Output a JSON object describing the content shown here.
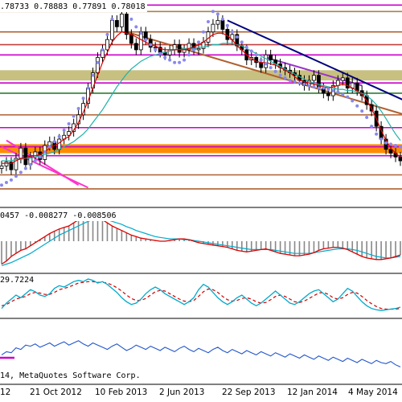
{
  "chart_data": {
    "type": "line",
    "header": {
      "ohlc_text": ".78733 0.78883 0.77891 0.78018",
      "macd_text": "0457 -0.008277 -0.008506",
      "rsi_text": "29.7224",
      "copyright_text": "14, MetaQuotes Software Corp."
    },
    "x_ticks": [
      "12",
      "21 Oct 2012",
      "10 Feb 2013",
      "2 Jun 2013",
      "22 Sep 2013",
      "12 Jan 2014",
      "4 May 2014"
    ],
    "main": {
      "ylim": [
        0.745,
        0.905
      ],
      "series": {
        "close": [
          0.775,
          0.778,
          0.772,
          0.781,
          0.789,
          0.776,
          0.782,
          0.786,
          0.78,
          0.791,
          0.794,
          0.788,
          0.796,
          0.799,
          0.802,
          0.808,
          0.815,
          0.824,
          0.836,
          0.848,
          0.86,
          0.866,
          0.874,
          0.889,
          0.884,
          0.894,
          0.878,
          0.871,
          0.866,
          0.88,
          0.874,
          0.868,
          0.868,
          0.864,
          0.862,
          0.866,
          0.87,
          0.864,
          0.866,
          0.871,
          0.866,
          0.867,
          0.872,
          0.88,
          0.886,
          0.889,
          0.882,
          0.874,
          0.878,
          0.869,
          0.866,
          0.858,
          0.86,
          0.856,
          0.852,
          0.862,
          0.858,
          0.855,
          0.852,
          0.85,
          0.848,
          0.846,
          0.842,
          0.838,
          0.842,
          0.846,
          0.836,
          0.832,
          0.83,
          0.838,
          0.842,
          0.844,
          0.836,
          0.84,
          0.834,
          0.83,
          0.823,
          0.818,
          0.806,
          0.796,
          0.788,
          0.785,
          0.782,
          0.779
        ],
        "ma_fast": [
          0.777,
          0.777,
          0.777,
          0.779,
          0.781,
          0.781,
          0.783,
          0.783,
          0.784,
          0.786,
          0.789,
          0.791,
          0.793,
          0.796,
          0.798,
          0.803,
          0.809,
          0.817,
          0.826,
          0.836,
          0.846,
          0.856,
          0.864,
          0.872,
          0.877,
          0.88,
          0.879,
          0.878,
          0.876,
          0.874,
          0.872,
          0.87,
          0.869,
          0.867,
          0.866,
          0.866,
          0.866,
          0.866,
          0.866,
          0.867,
          0.868,
          0.87,
          0.872,
          0.875,
          0.878,
          0.879,
          0.879,
          0.877,
          0.874,
          0.869,
          0.866,
          0.862,
          0.859,
          0.857,
          0.856,
          0.856,
          0.855,
          0.854,
          0.852,
          0.85,
          0.848,
          0.845,
          0.842,
          0.841,
          0.84,
          0.839,
          0.838,
          0.837,
          0.836,
          0.837,
          0.838,
          0.839,
          0.838,
          0.836,
          0.834,
          0.831,
          0.826,
          0.82,
          0.812,
          0.803,
          0.795,
          0.789,
          0.785,
          0.782
        ],
        "ma_slow": [
          0.779,
          0.779,
          0.779,
          0.78,
          0.78,
          0.781,
          0.781,
          0.782,
          0.783,
          0.784,
          0.785,
          0.786,
          0.788,
          0.79,
          0.792,
          0.794,
          0.797,
          0.8,
          0.804,
          0.809,
          0.814,
          0.819,
          0.825,
          0.831,
          0.837,
          0.842,
          0.847,
          0.851,
          0.854,
          0.857,
          0.859,
          0.861,
          0.862,
          0.863,
          0.864,
          0.865,
          0.866,
          0.866,
          0.867,
          0.867,
          0.867,
          0.868,
          0.868,
          0.869,
          0.87,
          0.87,
          0.871,
          0.871,
          0.871,
          0.87,
          0.869,
          0.867,
          0.865,
          0.863,
          0.861,
          0.859,
          0.857,
          0.855,
          0.853,
          0.851,
          0.849,
          0.847,
          0.845,
          0.843,
          0.841,
          0.84,
          0.839,
          0.838,
          0.837,
          0.836,
          0.835,
          0.835,
          0.834,
          0.834,
          0.833,
          0.832,
          0.83,
          0.827,
          0.823,
          0.818,
          0.812,
          0.806,
          0.8,
          0.795
        ],
        "psar": [
          0.76,
          0.762,
          0.764,
          0.767,
          0.77,
          0.773,
          0.776,
          0.779,
          0.782,
          0.786,
          0.79,
          0.794,
          0.798,
          0.803,
          0.808,
          0.814,
          0.82,
          0.828,
          0.836,
          0.846,
          0.856,
          0.866,
          0.878,
          0.89,
          0.898,
          0.898,
          0.897,
          0.89,
          0.884,
          0.879,
          0.874,
          0.87,
          0.866,
          0.863,
          0.86,
          0.858,
          0.856,
          0.856,
          0.858,
          0.862,
          0.866,
          0.872,
          0.88,
          0.888,
          0.896,
          0.894,
          0.89,
          0.885,
          0.88,
          0.876,
          0.872,
          0.868,
          0.865,
          0.862,
          0.858,
          0.855,
          0.852,
          0.849,
          0.846,
          0.844,
          0.842,
          0.841,
          0.84,
          0.839,
          0.838,
          0.837,
          0.836,
          0.836,
          0.835,
          0.834,
          0.833,
          0.831,
          0.829,
          0.826,
          0.822,
          0.818,
          0.813,
          0.806,
          0.8,
          0.796,
          0.793,
          0.792,
          0.791,
          0.79
        ]
      },
      "hlines": [
        {
          "y": 0.901,
          "color": "#cc00cc"
        },
        {
          "y": 0.896,
          "color": "#b08040"
        },
        {
          "y": 0.88,
          "color": "#b06030"
        },
        {
          "y": 0.87,
          "color": "#c04040"
        },
        {
          "y": 0.862,
          "color": "#cc00cc"
        },
        {
          "y": 0.84,
          "color": "#cc00cc"
        },
        {
          "y": 0.832,
          "color": "#2e7d32"
        },
        {
          "y": 0.815,
          "color": "#b06030"
        },
        {
          "y": 0.805,
          "color": "#cc00cc"
        },
        {
          "y": 0.79,
          "color": "#cc00cc"
        },
        {
          "y": 0.783,
          "color": "#cc00cc"
        },
        {
          "y": 0.768,
          "color": "#b06030"
        },
        {
          "y": 0.757,
          "color": "#b06030"
        }
      ],
      "bands": [
        {
          "y0": 0.85,
          "y1": 0.842,
          "color": "#c8c080"
        },
        {
          "y0": 0.792,
          "y1": 0.785,
          "color": "#ff8c00"
        }
      ],
      "trendlines": [
        {
          "x0": 47,
          "y0": 0.889,
          "x1": 84,
          "y1": 0.826,
          "color": "#000080"
        },
        {
          "x0": 26,
          "y0": 0.88,
          "x1": 84,
          "y1": 0.815,
          "color": "#b06030"
        },
        {
          "x0": 55,
          "y0": 0.86,
          "x1": 75,
          "y1": 0.838,
          "color": "#9933cc"
        },
        {
          "x0": 0,
          "y0": 0.79,
          "x1": 18,
          "y1": 0.758,
          "color": "#ff33cc"
        },
        {
          "x0": 1,
          "y0": 0.795,
          "x1": 16,
          "y1": 0.76,
          "color": "#ff33cc"
        }
      ]
    },
    "macd": {
      "ylim": [
        -0.04,
        0.04
      ],
      "main_line": [
        -0.03,
        -0.026,
        -0.02,
        -0.016,
        -0.012,
        -0.01,
        -0.006,
        -0.002,
        0.002,
        0.006,
        0.01,
        0.013,
        0.016,
        0.018,
        0.02,
        0.024,
        0.028,
        0.031,
        0.033,
        0.035,
        0.032,
        0.028,
        0.024,
        0.02,
        0.017,
        0.014,
        0.011,
        0.008,
        0.006,
        0.004,
        0.003,
        0.002,
        0.001,
        0.0,
        0.0,
        0.001,
        0.002,
        0.003,
        0.003,
        0.002,
        0.0,
        -0.002,
        -0.003,
        -0.004,
        -0.005,
        -0.006,
        -0.007,
        -0.008,
        -0.01,
        -0.012,
        -0.013,
        -0.014,
        -0.013,
        -0.012,
        -0.011,
        -0.01,
        -0.012,
        -0.014,
        -0.016,
        -0.017,
        -0.018,
        -0.019,
        -0.019,
        -0.018,
        -0.017,
        -0.015,
        -0.012,
        -0.01,
        -0.009,
        -0.008,
        -0.008,
        -0.009,
        -0.011,
        -0.014,
        -0.017,
        -0.02,
        -0.022,
        -0.023,
        -0.024,
        -0.024,
        -0.023,
        -0.022,
        -0.02,
        -0.018
      ],
      "signal_line": [
        -0.032,
        -0.03,
        -0.028,
        -0.025,
        -0.022,
        -0.019,
        -0.016,
        -0.012,
        -0.008,
        -0.004,
        0.0,
        0.004,
        0.008,
        0.011,
        0.014,
        0.017,
        0.02,
        0.023,
        0.026,
        0.028,
        0.029,
        0.029,
        0.028,
        0.026,
        0.024,
        0.022,
        0.019,
        0.017,
        0.014,
        0.012,
        0.01,
        0.008,
        0.006,
        0.005,
        0.004,
        0.003,
        0.003,
        0.003,
        0.002,
        0.002,
        0.001,
        0.0,
        -0.001,
        -0.002,
        -0.003,
        -0.004,
        -0.005,
        -0.006,
        -0.007,
        -0.008,
        -0.009,
        -0.01,
        -0.011,
        -0.011,
        -0.011,
        -0.011,
        -0.011,
        -0.012,
        -0.013,
        -0.014,
        -0.015,
        -0.016,
        -0.016,
        -0.016,
        -0.016,
        -0.015,
        -0.014,
        -0.013,
        -0.012,
        -0.011,
        -0.01,
        -0.01,
        -0.01,
        -0.011,
        -0.012,
        -0.014,
        -0.016,
        -0.018,
        -0.02,
        -0.021,
        -0.022,
        -0.022,
        -0.021,
        -0.02
      ],
      "colors": {
        "main": "#00aacc",
        "signal": "#dd0000",
        "hist": "#888888"
      }
    },
    "rsi": {
      "ylim": [
        20,
        80
      ],
      "fast": [
        30,
        38,
        44,
        50,
        46,
        52,
        58,
        55,
        50,
        48,
        52,
        60,
        64,
        62,
        66,
        70,
        72,
        70,
        74,
        72,
        68,
        70,
        66,
        60,
        54,
        46,
        40,
        36,
        38,
        44,
        52,
        58,
        62,
        58,
        52,
        48,
        44,
        40,
        36,
        40,
        46,
        58,
        66,
        62,
        54,
        46,
        40,
        36,
        40,
        46,
        50,
        44,
        38,
        34,
        38,
        44,
        50,
        56,
        50,
        44,
        38,
        36,
        40,
        46,
        52,
        56,
        58,
        52,
        46,
        40,
        44,
        52,
        60,
        56,
        48,
        40,
        34,
        30,
        28,
        27,
        28,
        29,
        30,
        32
      ],
      "slow": [
        34,
        36,
        40,
        44,
        46,
        48,
        52,
        54,
        53,
        51,
        51,
        54,
        58,
        60,
        62,
        65,
        68,
        69,
        70,
        70,
        69,
        69,
        68,
        65,
        61,
        56,
        50,
        45,
        42,
        42,
        45,
        50,
        55,
        57,
        56,
        52,
        48,
        44,
        41,
        40,
        42,
        48,
        55,
        59,
        58,
        54,
        48,
        43,
        41,
        42,
        45,
        46,
        44,
        40,
        38,
        39,
        43,
        48,
        50,
        48,
        44,
        40,
        39,
        41,
        45,
        49,
        53,
        54,
        51,
        46,
        44,
        46,
        51,
        54,
        53,
        48,
        42,
        37,
        33,
        30,
        29,
        29,
        29,
        30
      ],
      "colors": {
        "fast": "#00aacc",
        "slow": "#cc0000"
      }
    },
    "bottom": {
      "ylim": [
        0,
        100
      ],
      "values": [
        42,
        48,
        46,
        55,
        52,
        60,
        58,
        62,
        56,
        60,
        64,
        58,
        62,
        66,
        60,
        64,
        68,
        62,
        58,
        64,
        60,
        56,
        52,
        58,
        62,
        56,
        50,
        54,
        60,
        56,
        52,
        58,
        54,
        50,
        56,
        52,
        48,
        54,
        58,
        52,
        48,
        54,
        50,
        46,
        52,
        56,
        50,
        46,
        52,
        48,
        44,
        50,
        46,
        42,
        48,
        44,
        40,
        46,
        42,
        38,
        44,
        40,
        36,
        42,
        38,
        34,
        40,
        36,
        32,
        38,
        34,
        30,
        36,
        32,
        28,
        34,
        30,
        26,
        32,
        28,
        26,
        30,
        24,
        20
      ],
      "color": "#2255cc",
      "marker_color": "#cc00cc"
    }
  }
}
